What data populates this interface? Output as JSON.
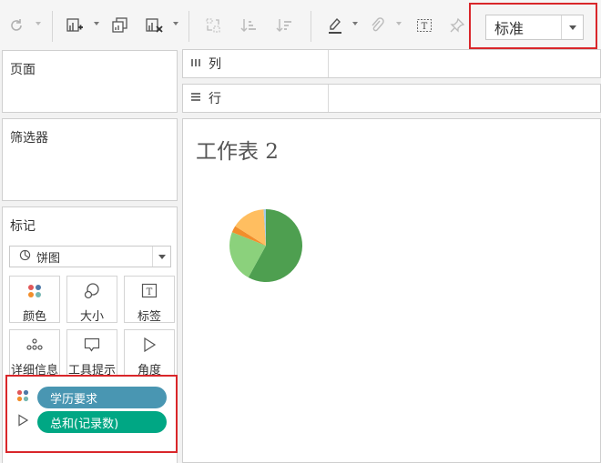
{
  "toolbar": {
    "view_mode": "标准"
  },
  "panels": {
    "pages_title": "页面",
    "filters_title": "筛选器",
    "marks_title": "标记"
  },
  "shelves": {
    "columns_label": "列",
    "rows_label": "行"
  },
  "marks": {
    "mark_type": "饼图",
    "cards": [
      {
        "label": "颜色",
        "icon": "color-icon"
      },
      {
        "label": "大小",
        "icon": "size-icon"
      },
      {
        "label": "标签",
        "icon": "label-icon"
      },
      {
        "label": "详细信息",
        "icon": "detail-icon"
      },
      {
        "label": "工具提示",
        "icon": "tooltip-icon"
      },
      {
        "label": "角度",
        "icon": "angle-icon"
      }
    ],
    "pills": [
      {
        "field": "学历要求",
        "encoding": "color",
        "color": "#4996b2"
      },
      {
        "field": "总和(记录数)",
        "encoding": "angle",
        "color": "#00a784"
      }
    ]
  },
  "sheet": {
    "title": "工作表 2"
  },
  "chart_data": {
    "type": "pie",
    "slices": [
      {
        "value": 58,
        "color": "#4e9f50"
      },
      {
        "value": 23,
        "color": "#8bd17c"
      },
      {
        "value": 3,
        "color": "#f28e2b"
      },
      {
        "value": 15,
        "color": "#ffbe60"
      },
      {
        "value": 1,
        "color": "#a0cbe8"
      }
    ]
  }
}
